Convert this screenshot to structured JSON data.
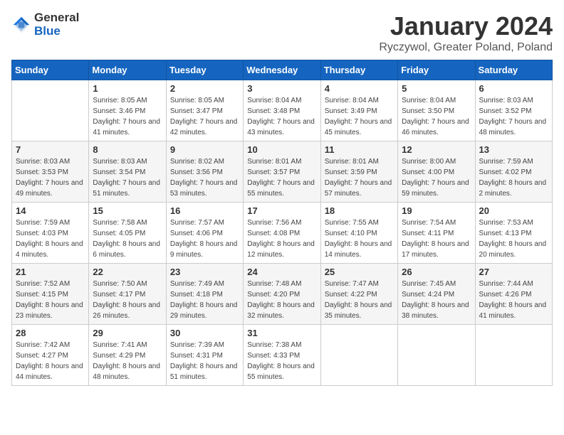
{
  "header": {
    "logo_general": "General",
    "logo_blue": "Blue",
    "title": "January 2024",
    "subtitle": "Ryczywol, Greater Poland, Poland"
  },
  "calendar": {
    "days_of_week": [
      "Sunday",
      "Monday",
      "Tuesday",
      "Wednesday",
      "Thursday",
      "Friday",
      "Saturday"
    ],
    "weeks": [
      [
        {
          "day": "",
          "sunrise": "",
          "sunset": "",
          "daylight": ""
        },
        {
          "day": "1",
          "sunrise": "Sunrise: 8:05 AM",
          "sunset": "Sunset: 3:46 PM",
          "daylight": "Daylight: 7 hours and 41 minutes."
        },
        {
          "day": "2",
          "sunrise": "Sunrise: 8:05 AM",
          "sunset": "Sunset: 3:47 PM",
          "daylight": "Daylight: 7 hours and 42 minutes."
        },
        {
          "day": "3",
          "sunrise": "Sunrise: 8:04 AM",
          "sunset": "Sunset: 3:48 PM",
          "daylight": "Daylight: 7 hours and 43 minutes."
        },
        {
          "day": "4",
          "sunrise": "Sunrise: 8:04 AM",
          "sunset": "Sunset: 3:49 PM",
          "daylight": "Daylight: 7 hours and 45 minutes."
        },
        {
          "day": "5",
          "sunrise": "Sunrise: 8:04 AM",
          "sunset": "Sunset: 3:50 PM",
          "daylight": "Daylight: 7 hours and 46 minutes."
        },
        {
          "day": "6",
          "sunrise": "Sunrise: 8:03 AM",
          "sunset": "Sunset: 3:52 PM",
          "daylight": "Daylight: 7 hours and 48 minutes."
        }
      ],
      [
        {
          "day": "7",
          "sunrise": "Sunrise: 8:03 AM",
          "sunset": "Sunset: 3:53 PM",
          "daylight": "Daylight: 7 hours and 49 minutes."
        },
        {
          "day": "8",
          "sunrise": "Sunrise: 8:03 AM",
          "sunset": "Sunset: 3:54 PM",
          "daylight": "Daylight: 7 hours and 51 minutes."
        },
        {
          "day": "9",
          "sunrise": "Sunrise: 8:02 AM",
          "sunset": "Sunset: 3:56 PM",
          "daylight": "Daylight: 7 hours and 53 minutes."
        },
        {
          "day": "10",
          "sunrise": "Sunrise: 8:01 AM",
          "sunset": "Sunset: 3:57 PM",
          "daylight": "Daylight: 7 hours and 55 minutes."
        },
        {
          "day": "11",
          "sunrise": "Sunrise: 8:01 AM",
          "sunset": "Sunset: 3:59 PM",
          "daylight": "Daylight: 7 hours and 57 minutes."
        },
        {
          "day": "12",
          "sunrise": "Sunrise: 8:00 AM",
          "sunset": "Sunset: 4:00 PM",
          "daylight": "Daylight: 7 hours and 59 minutes."
        },
        {
          "day": "13",
          "sunrise": "Sunrise: 7:59 AM",
          "sunset": "Sunset: 4:02 PM",
          "daylight": "Daylight: 8 hours and 2 minutes."
        }
      ],
      [
        {
          "day": "14",
          "sunrise": "Sunrise: 7:59 AM",
          "sunset": "Sunset: 4:03 PM",
          "daylight": "Daylight: 8 hours and 4 minutes."
        },
        {
          "day": "15",
          "sunrise": "Sunrise: 7:58 AM",
          "sunset": "Sunset: 4:05 PM",
          "daylight": "Daylight: 8 hours and 6 minutes."
        },
        {
          "day": "16",
          "sunrise": "Sunrise: 7:57 AM",
          "sunset": "Sunset: 4:06 PM",
          "daylight": "Daylight: 8 hours and 9 minutes."
        },
        {
          "day": "17",
          "sunrise": "Sunrise: 7:56 AM",
          "sunset": "Sunset: 4:08 PM",
          "daylight": "Daylight: 8 hours and 12 minutes."
        },
        {
          "day": "18",
          "sunrise": "Sunrise: 7:55 AM",
          "sunset": "Sunset: 4:10 PM",
          "daylight": "Daylight: 8 hours and 14 minutes."
        },
        {
          "day": "19",
          "sunrise": "Sunrise: 7:54 AM",
          "sunset": "Sunset: 4:11 PM",
          "daylight": "Daylight: 8 hours and 17 minutes."
        },
        {
          "day": "20",
          "sunrise": "Sunrise: 7:53 AM",
          "sunset": "Sunset: 4:13 PM",
          "daylight": "Daylight: 8 hours and 20 minutes."
        }
      ],
      [
        {
          "day": "21",
          "sunrise": "Sunrise: 7:52 AM",
          "sunset": "Sunset: 4:15 PM",
          "daylight": "Daylight: 8 hours and 23 minutes."
        },
        {
          "day": "22",
          "sunrise": "Sunrise: 7:50 AM",
          "sunset": "Sunset: 4:17 PM",
          "daylight": "Daylight: 8 hours and 26 minutes."
        },
        {
          "day": "23",
          "sunrise": "Sunrise: 7:49 AM",
          "sunset": "Sunset: 4:18 PM",
          "daylight": "Daylight: 8 hours and 29 minutes."
        },
        {
          "day": "24",
          "sunrise": "Sunrise: 7:48 AM",
          "sunset": "Sunset: 4:20 PM",
          "daylight": "Daylight: 8 hours and 32 minutes."
        },
        {
          "day": "25",
          "sunrise": "Sunrise: 7:47 AM",
          "sunset": "Sunset: 4:22 PM",
          "daylight": "Daylight: 8 hours and 35 minutes."
        },
        {
          "day": "26",
          "sunrise": "Sunrise: 7:45 AM",
          "sunset": "Sunset: 4:24 PM",
          "daylight": "Daylight: 8 hours and 38 minutes."
        },
        {
          "day": "27",
          "sunrise": "Sunrise: 7:44 AM",
          "sunset": "Sunset: 4:26 PM",
          "daylight": "Daylight: 8 hours and 41 minutes."
        }
      ],
      [
        {
          "day": "28",
          "sunrise": "Sunrise: 7:42 AM",
          "sunset": "Sunset: 4:27 PM",
          "daylight": "Daylight: 8 hours and 44 minutes."
        },
        {
          "day": "29",
          "sunrise": "Sunrise: 7:41 AM",
          "sunset": "Sunset: 4:29 PM",
          "daylight": "Daylight: 8 hours and 48 minutes."
        },
        {
          "day": "30",
          "sunrise": "Sunrise: 7:39 AM",
          "sunset": "Sunset: 4:31 PM",
          "daylight": "Daylight: 8 hours and 51 minutes."
        },
        {
          "day": "31",
          "sunrise": "Sunrise: 7:38 AM",
          "sunset": "Sunset: 4:33 PM",
          "daylight": "Daylight: 8 hours and 55 minutes."
        },
        {
          "day": "",
          "sunrise": "",
          "sunset": "",
          "daylight": ""
        },
        {
          "day": "",
          "sunrise": "",
          "sunset": "",
          "daylight": ""
        },
        {
          "day": "",
          "sunrise": "",
          "sunset": "",
          "daylight": ""
        }
      ]
    ]
  }
}
